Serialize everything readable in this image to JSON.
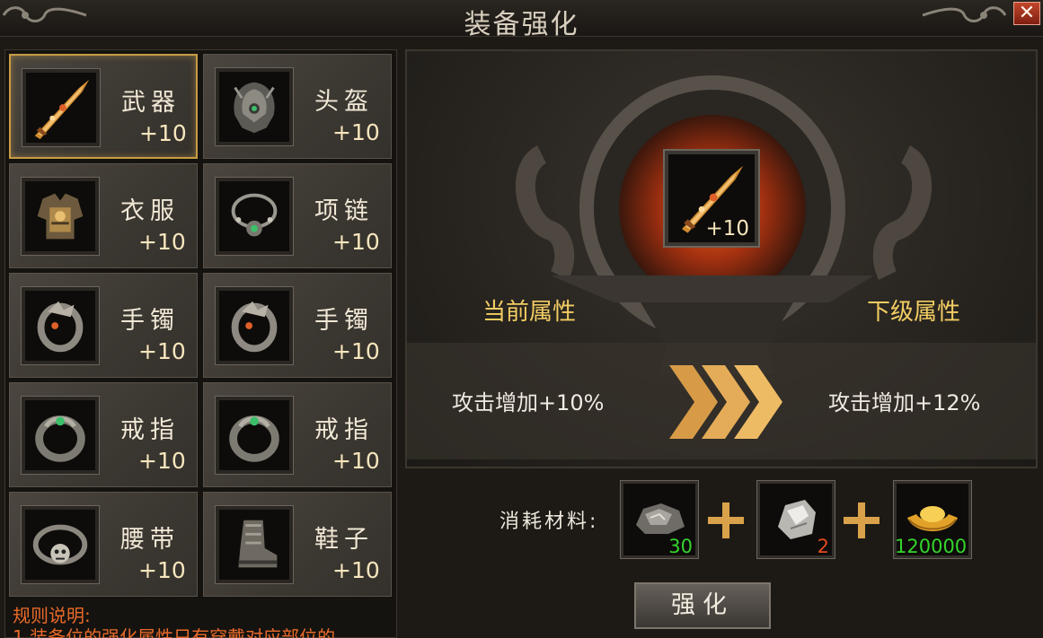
{
  "window": {
    "title": "装备强化",
    "close_label": "✕"
  },
  "slots": [
    {
      "name": "武器",
      "level": "+10",
      "icon": "sword-icon",
      "selected": true
    },
    {
      "name": "头盔",
      "level": "+10",
      "icon": "helmet-icon"
    },
    {
      "name": "衣服",
      "level": "+10",
      "icon": "armor-icon"
    },
    {
      "name": "项链",
      "level": "+10",
      "icon": "necklace-icon"
    },
    {
      "name": "手镯",
      "level": "+10",
      "icon": "bracelet-icon"
    },
    {
      "name": "手镯",
      "level": "+10",
      "icon": "bracelet-icon"
    },
    {
      "name": "戒指",
      "level": "+10",
      "icon": "ring-icon"
    },
    {
      "name": "戒指",
      "level": "+10",
      "icon": "ring-icon"
    },
    {
      "name": "腰带",
      "level": "+10",
      "icon": "belt-icon"
    },
    {
      "name": "鞋子",
      "level": "+10",
      "icon": "boots-icon"
    }
  ],
  "rules": {
    "title": "规则说明:",
    "line1": "1.装备位的强化属性只有穿戴对应部位的"
  },
  "forge": {
    "item_level": "+10",
    "current_label": "当前属性",
    "next_label": "下级属性",
    "current_value": "攻击增加+10%",
    "next_value": "攻击增加+12%"
  },
  "cost": {
    "label": "消耗材料:",
    "materials": [
      {
        "icon": "ore-icon",
        "qty": "30",
        "color": "#35d42c"
      },
      {
        "icon": "stone-icon",
        "qty": "2",
        "color": "#e34a1e"
      },
      {
        "icon": "gold-ingot-icon",
        "qty": "120000",
        "color": "#35d42c"
      }
    ]
  },
  "button": {
    "label": "强化"
  },
  "colors": {
    "accent_gold": "#f2cd62",
    "selected_border": "#c89c45",
    "rules_text": "#e96a2a"
  }
}
